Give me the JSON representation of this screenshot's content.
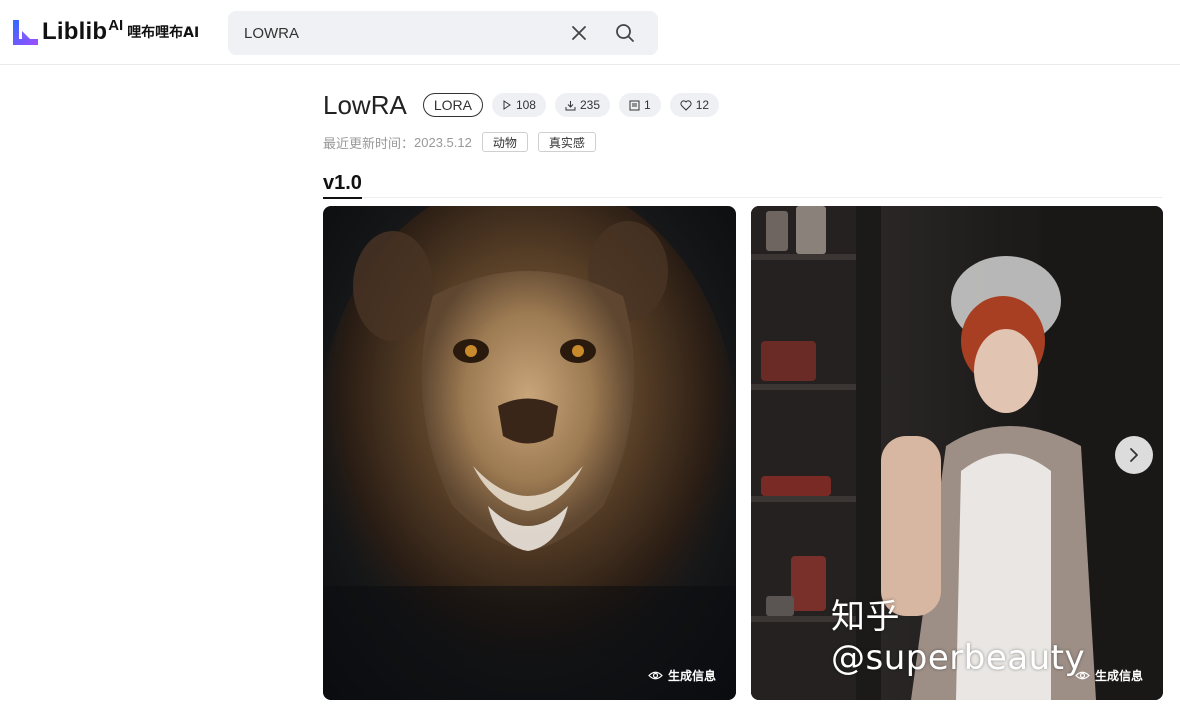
{
  "header": {
    "logo": {
      "text": "Liblib",
      "ai": "AI",
      "cn": "哩布哩布AI"
    },
    "search": {
      "value": "LOWRA",
      "placeholder": ""
    }
  },
  "model": {
    "title": "LowRA",
    "type": "LORA",
    "stats": {
      "runs": "108",
      "downloads": "235",
      "images": "1",
      "likes": "12"
    },
    "update_label": "最近更新时间：",
    "update_date": "2023.5.12",
    "tags": [
      "动物",
      "真实感"
    ],
    "versions": [
      "v1.0"
    ]
  },
  "gallery": {
    "items": [
      {
        "alt": "lion portrait",
        "gen_info": "生成信息"
      },
      {
        "alt": "red-haired maid portrait",
        "gen_info": "生成信息"
      }
    ],
    "watermark": "知乎 @superbeauty"
  },
  "colors": {
    "accent": "#111111",
    "search_bg": "#f0f1f5",
    "stat_bg": "#eef0f3",
    "logo_gradient": [
      "#2f6bff",
      "#9b4dff"
    ]
  },
  "icons": {
    "clear": "close-icon",
    "search": "search-icon",
    "run": "play-icon",
    "download": "download-icon",
    "images": "image-icon",
    "like": "heart-icon",
    "eye": "eye-icon",
    "next": "chevron-right-icon"
  }
}
